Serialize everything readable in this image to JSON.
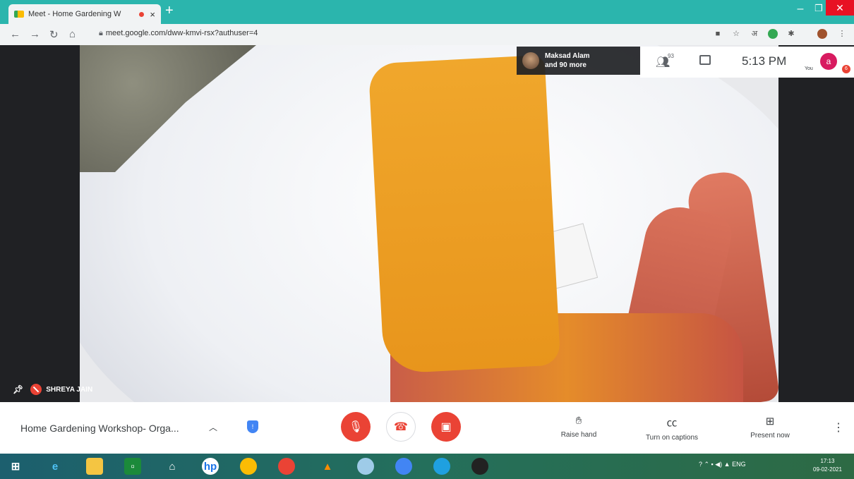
{
  "browser": {
    "tab_title": "Meet - Home Gardening W",
    "tab_close": "×",
    "new_tab": "+",
    "url": "meet.google.com/dww-kmvi-rsx?authuser=4"
  },
  "meet": {
    "speaker": {
      "name": "Maksad Alam",
      "more": "and 90 more"
    },
    "participants_count": "93",
    "clock": "5:13 PM",
    "you_label": "You",
    "avatar_letter": "a",
    "badge": "6",
    "pinned_name": "SHREYA JAIN",
    "meeting_title": "Home Gardening Workshop- Orga...",
    "actions": {
      "raise_hand": "Raise hand",
      "captions": "Turn on captions",
      "present": "Present now"
    }
  },
  "taskbar": {
    "tray_lang": "ENG",
    "time": "17:13",
    "date": "09-02-2021"
  },
  "icons": {
    "colors": {
      "meet_red": "#ea4335",
      "teal_titlebar": "#2bb5ad",
      "avatar_pink": "#d81b60"
    }
  }
}
